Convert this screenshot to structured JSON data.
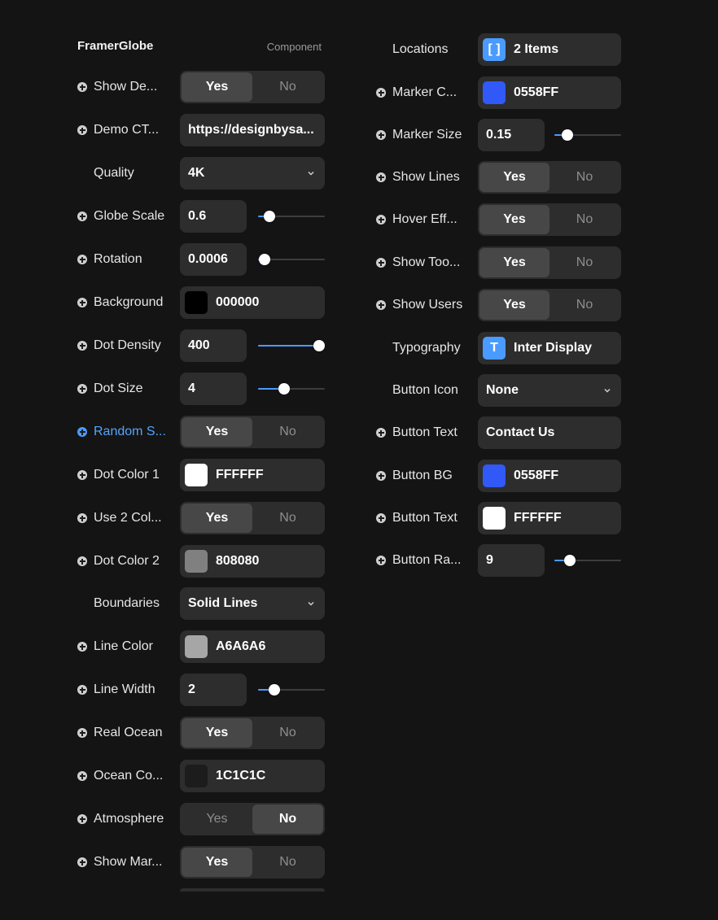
{
  "header": {
    "title": "FramerGlobe",
    "subtitle": "Component"
  },
  "left": {
    "show_demo": {
      "label": "Show De...",
      "yes": "Yes",
      "no": "No",
      "selected": "yes"
    },
    "demo_cta": {
      "label": "Demo CT...",
      "value": "https://designbysa..."
    },
    "quality": {
      "label": "Quality",
      "value": "4K"
    },
    "globe_scale": {
      "label": "Globe Scale",
      "value": "0.6",
      "fraction": 0.17
    },
    "rotation": {
      "label": "Rotation",
      "value": "0.0006",
      "fraction": 0.1
    },
    "background": {
      "label": "Background",
      "value": "000000",
      "color": "#000000"
    },
    "dot_density": {
      "label": "Dot Density",
      "value": "400",
      "fraction": 0.92
    },
    "dot_size": {
      "label": "Dot Size",
      "value": "4",
      "fraction": 0.39
    },
    "random_size": {
      "label": "Random S...",
      "yes": "Yes",
      "no": "No",
      "selected": "yes"
    },
    "dot_color_1": {
      "label": "Dot Color 1",
      "value": "FFFFFF",
      "color": "#FFFFFF"
    },
    "use_2_colors": {
      "label": "Use 2 Col...",
      "yes": "Yes",
      "no": "No",
      "selected": "yes"
    },
    "dot_color_2": {
      "label": "Dot Color 2",
      "value": "808080",
      "color": "#808080"
    },
    "boundaries": {
      "label": "Boundaries",
      "value": "Solid Lines"
    },
    "line_color": {
      "label": "Line Color",
      "value": "A6A6A6",
      "color": "#A6A6A6"
    },
    "line_width": {
      "label": "Line Width",
      "value": "2",
      "fraction": 0.24
    },
    "real_ocean": {
      "label": "Real Ocean",
      "yes": "Yes",
      "no": "No",
      "selected": "yes"
    },
    "ocean_color": {
      "label": "Ocean Co...",
      "value": "1C1C1C",
      "color": "#1C1C1C"
    },
    "atmosphere": {
      "label": "Atmosphere",
      "yes": "Yes",
      "no": "No",
      "selected": "no"
    },
    "show_markers": {
      "label": "Show Mar...",
      "yes": "Yes",
      "no": "No",
      "selected": "yes"
    }
  },
  "right": {
    "locations": {
      "label": "Locations",
      "value": "2 Items",
      "icon": "array-brackets-icon"
    },
    "marker_color": {
      "label": "Marker C...",
      "value": "0558FF",
      "color": "#3059F8"
    },
    "marker_size": {
      "label": "Marker Size",
      "value": "0.15",
      "fraction": 0.2
    },
    "show_lines": {
      "label": "Show Lines",
      "yes": "Yes",
      "no": "No",
      "selected": "yes"
    },
    "hover_effect": {
      "label": "Hover Eff...",
      "yes": "Yes",
      "no": "No",
      "selected": "yes"
    },
    "show_tooltip": {
      "label": "Show Too...",
      "yes": "Yes",
      "no": "No",
      "selected": "yes"
    },
    "show_users": {
      "label": "Show Users",
      "yes": "Yes",
      "no": "No",
      "selected": "yes"
    },
    "typography": {
      "label": "Typography",
      "value": "Inter Display",
      "icon": "T"
    },
    "button_icon": {
      "label": "Button Icon",
      "value": "None"
    },
    "button_text": {
      "label": "Button Text",
      "value": "Contact Us"
    },
    "button_bg": {
      "label": "Button BG",
      "value": "0558FF",
      "color": "#3059F8"
    },
    "button_text_color": {
      "label": "Button Text",
      "value": "FFFFFF",
      "color": "#FFFFFF"
    },
    "button_radius": {
      "label": "Button Ra...",
      "value": "9",
      "fraction": 0.23
    }
  },
  "colors": {
    "accent": "#4A9BFF",
    "control_bg": "#2D2D2D",
    "selected_bg": "#474747",
    "page_bg": "#141414"
  }
}
